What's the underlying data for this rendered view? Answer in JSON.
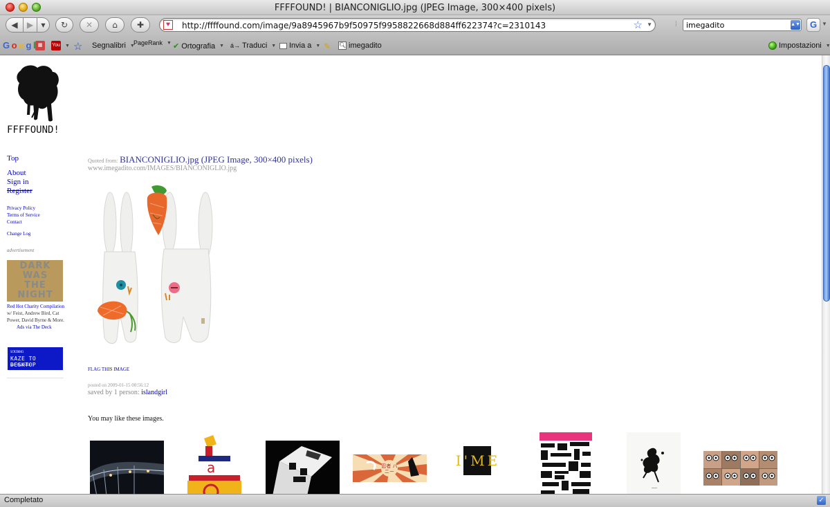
{
  "window": {
    "title": "FFFFOUND! | BIANCONIGLIO.jpg (JPEG Image, 300×400 pixels)"
  },
  "navigation": {
    "url": "http://ffffound.com/image/9a8945967b9f50975f9958822668d884ff622374?c=2310143",
    "search_value": "imegadito",
    "search_engine_icon": "G"
  },
  "toolbar": {
    "items": [
      {
        "label": "Segnalibri",
        "icon": "star-icon"
      },
      {
        "label": "PageRank",
        "icon": "pagerank-icon"
      },
      {
        "label": "Ortografia",
        "icon": "spellcheck-icon"
      },
      {
        "label": "Traduci",
        "icon": "translate-icon"
      },
      {
        "label": "Invia a",
        "icon": "send-icon"
      },
      {
        "label": "imegadito",
        "icon": "search-history-icon"
      }
    ],
    "settings_label": "Impostazioni"
  },
  "status": {
    "text": "Completato"
  },
  "sidebar": {
    "logo_text": "FFFFOUND!",
    "nav": {
      "top": "Top",
      "about": "About",
      "signin": "Sign in",
      "register": "Register"
    },
    "footer_links": {
      "privacy": "Privacy Policy",
      "terms": "Terms of Service",
      "contact": "Contact",
      "changelog": "Change Log"
    },
    "advertisement": {
      "label": "advertisement",
      "image_text": [
        "DARK",
        "WAS",
        "THE",
        "NIGHT"
      ],
      "link_text": "Red Hot Charity Compilation",
      "body_text": " w/ Feist, Andrew Bird, Cat Power, David Byrne & More.",
      "via": "Ads via The Deck"
    },
    "banner": {
      "line1": "SCRIBO01",
      "line2": "KAZE TO DESKTOP",
      "line3": "HAS RELEASED !"
    }
  },
  "main": {
    "quoted_label": "Quoted from:",
    "quoted_title": "BIANCONIGLIO.jpg (JPEG Image, 300×400 pixels)",
    "quoted_url": "www.imegadito.com/IMAGES/BIANCONIGLIO.jpg",
    "flag_label": "FLAG THIS IMAGE",
    "posted": "posted on 2009-01-15 00:56:12",
    "saved_prefix": "saved by 1 person: ",
    "saved_user": "islandgirl",
    "may_like_heading": "You may like these images."
  },
  "thumbs": {
    "t5_text": "I'ME",
    "t4_text": "忍者 バニー"
  },
  "colors": {
    "link": "#0000cc",
    "title_link": "#33339a",
    "meta_gray": "#999999",
    "scroll_thumb": "#5d8ede"
  }
}
